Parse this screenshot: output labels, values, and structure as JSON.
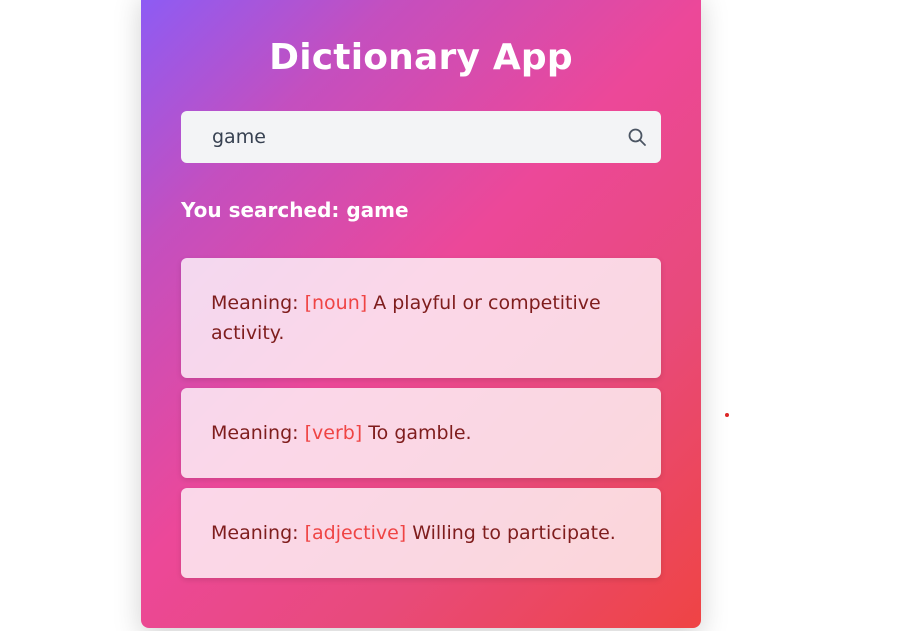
{
  "app": {
    "title": "Dictionary App"
  },
  "search": {
    "value": "game",
    "searched_prefix": "You searched: ",
    "searched_term": "game"
  },
  "meanings": [
    {
      "prefix": "Meaning: ",
      "pos": "[noun]",
      "definition": " A playful or competitive activity."
    },
    {
      "prefix": "Meaning: ",
      "pos": "[verb]",
      "definition": " To gamble."
    },
    {
      "prefix": "Meaning: ",
      "pos": "[adjective]",
      "definition": " Willing to participate."
    }
  ],
  "colors": {
    "gradient_start": "#8b5cf6",
    "gradient_mid": "#ec4899",
    "gradient_end": "#ef4444",
    "meaning_text": "#7f1d1d",
    "pos_text": "#ef4444"
  },
  "icons": {
    "search": "search-icon"
  }
}
